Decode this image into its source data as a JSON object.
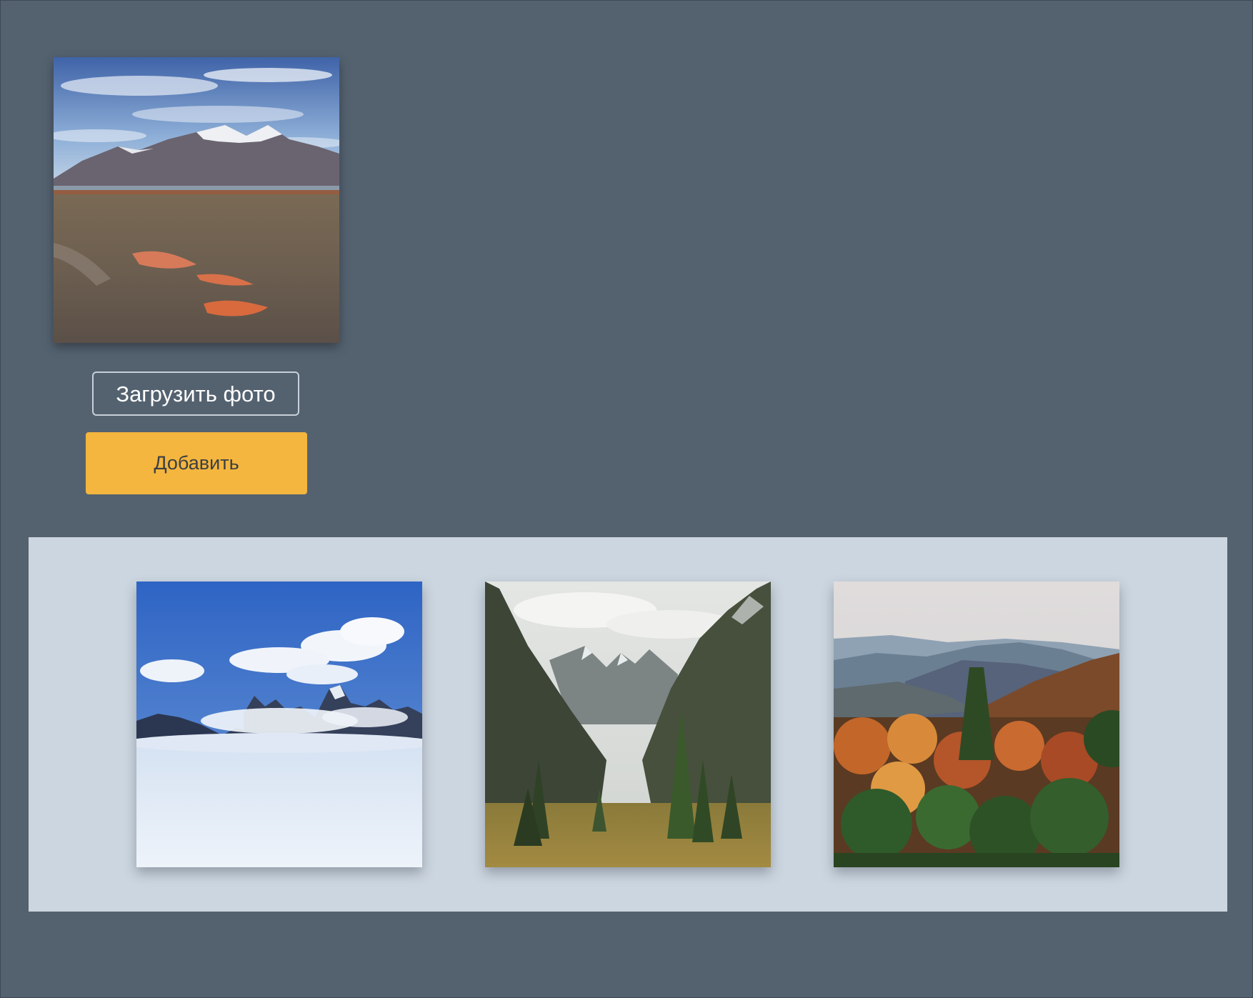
{
  "upload": {
    "preview_image": "mountain-tundra-photo",
    "upload_label": "Загрузить фото",
    "add_label": "Добавить"
  },
  "gallery": {
    "items": [
      {
        "image": "peaks-above-clouds-photo"
      },
      {
        "image": "mountain-valley-forest-photo"
      },
      {
        "image": "autumn-forest-hills-photo"
      }
    ]
  },
  "colors": {
    "page_background": "#546270",
    "gallery_background": "#ccd6e0",
    "add_button": "#f4b63e"
  }
}
